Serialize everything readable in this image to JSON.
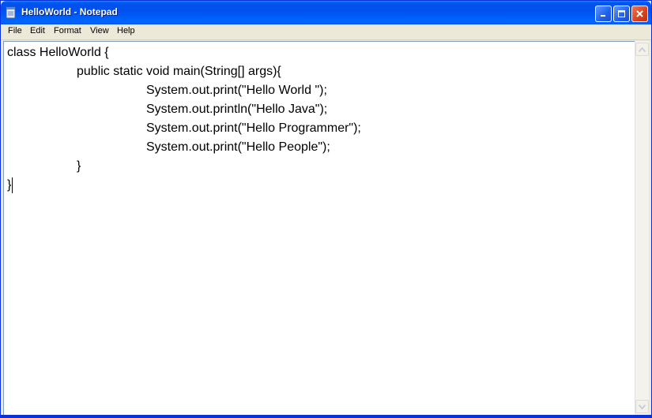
{
  "window": {
    "title": "HelloWorld - Notepad",
    "icon": "notepad-icon",
    "controls": [
      "minimize-icon",
      "maximize-icon",
      "close-icon"
    ]
  },
  "menubar": {
    "items": [
      "File",
      "Edit",
      "Format",
      "View",
      "Help"
    ]
  },
  "editor": {
    "lines": [
      "class HelloWorld {",
      "\t\tpublic static void main(String[] args){",
      "\t\t\t\tSystem.out.print(\"Hello World \");",
      "\t\t\t\tSystem.out.println(\"Hello Java\");",
      "\t\t\t\tSystem.out.print(\"Hello Programmer\");",
      "\t\t\t\tSystem.out.print(\"Hello People\");",
      "\t\t}",
      "}"
    ]
  },
  "colors": {
    "titlebar": "#0053ee",
    "editor_bg": "#ffffff",
    "text": "#000000",
    "close_button": "#d8421c"
  }
}
